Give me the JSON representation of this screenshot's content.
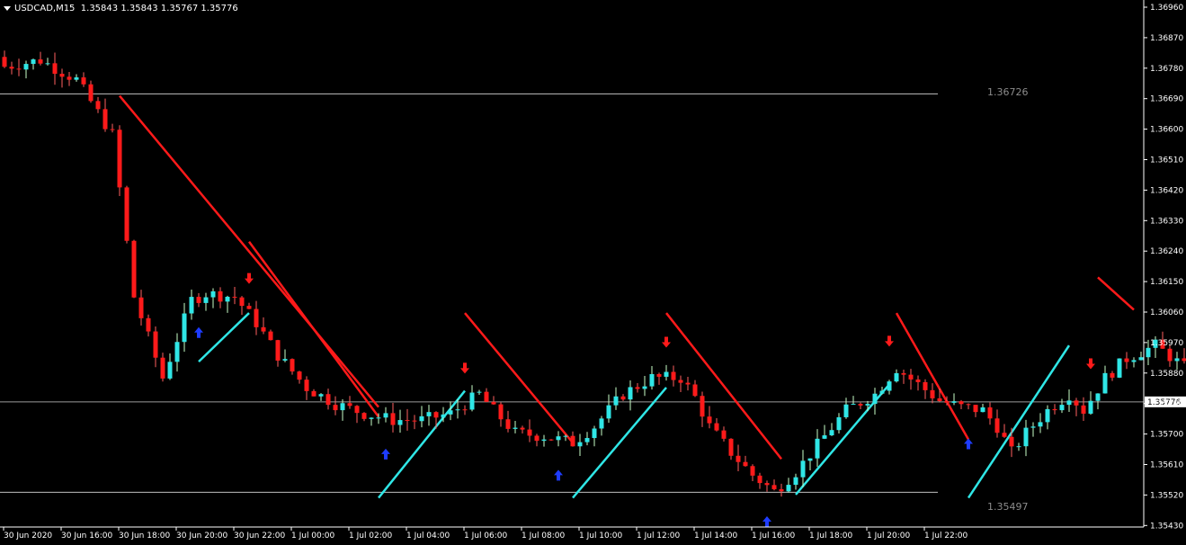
{
  "header": {
    "symbol": "USDCAD,M15",
    "ohlc": "1.35843 1.35843 1.35767 1.35776"
  },
  "levels": {
    "upper": "1.36726",
    "lower": "1.35497",
    "current": "1.35776"
  },
  "colors": {
    "background": "#000000",
    "bull": "#2fe6e6",
    "bear": "#ff1a1a",
    "buy_arrow": "#1e3cff",
    "sell_arrow": "#ff1a1a",
    "level_line": "#bfbfbf"
  },
  "chart_data": {
    "type": "candlestick",
    "ylim": [
      1.3539,
      1.3701
    ],
    "y_ticks": [
      "1.36960",
      "1.36870",
      "1.36780",
      "1.36690",
      "1.36600",
      "1.36510",
      "1.36420",
      "1.36330",
      "1.36240",
      "1.36150",
      "1.36060",
      "1.35970",
      "1.35880",
      "1.35790",
      "1.35700",
      "1.35610",
      "1.35520",
      "1.35430"
    ],
    "x_ticks": [
      "30 Jun 2020",
      "30 Jun 16:00",
      "30 Jun 18:00",
      "30 Jun 20:00",
      "30 Jun 22:00",
      "1 Jul 00:00",
      "1 Jul 02:00",
      "1 Jul 04:00",
      "1 Jul 06:00",
      "1 Jul 08:00",
      "1 Jul 10:00",
      "1 Jul 12:00",
      "1 Jul 14:00",
      "1 Jul 16:00",
      "1 Jul 18:00",
      "1 Jul 20:00",
      "1 Jul 22:00"
    ],
    "horizontal_levels": [
      1.36726,
      1.35497,
      1.35776
    ],
    "candle_close_path": [
      [
        0,
        1.3681
      ],
      [
        5,
        1.3683
      ],
      [
        10,
        1.3677
      ],
      [
        15,
        1.366
      ],
      [
        18,
        1.361
      ],
      [
        22,
        1.3585
      ],
      [
        26,
        1.3609
      ],
      [
        28,
        1.3611
      ],
      [
        32,
        1.361
      ],
      [
        35,
        1.3602
      ],
      [
        38,
        1.3592
      ],
      [
        42,
        1.3582
      ],
      [
        46,
        1.3577
      ],
      [
        50,
        1.3574
      ],
      [
        54,
        1.3572
      ],
      [
        58,
        1.3572
      ],
      [
        62,
        1.3574
      ],
      [
        66,
        1.358
      ],
      [
        68,
        1.3575
      ],
      [
        71,
        1.3568
      ],
      [
        75,
        1.3567
      ],
      [
        79,
        1.3565
      ],
      [
        82,
        1.357
      ],
      [
        86,
        1.358
      ],
      [
        90,
        1.3585
      ],
      [
        94,
        1.3585
      ],
      [
        96,
        1.3579
      ],
      [
        98,
        1.357
      ],
      [
        101,
        1.3562
      ],
      [
        104,
        1.3555
      ],
      [
        107,
        1.355
      ],
      [
        110,
        1.3556
      ],
      [
        114,
        1.3567
      ],
      [
        117,
        1.3575
      ],
      [
        121,
        1.358
      ],
      [
        124,
        1.3588
      ],
      [
        127,
        1.3583
      ],
      [
        130,
        1.3578
      ],
      [
        133,
        1.3576
      ],
      [
        136,
        1.3575
      ],
      [
        138,
        1.357
      ],
      [
        140,
        1.3562
      ],
      [
        142,
        1.3568
      ],
      [
        145,
        1.3575
      ],
      [
        148,
        1.358
      ],
      [
        150,
        1.3575
      ],
      [
        153,
        1.3585
      ],
      [
        156,
        1.3591
      ],
      [
        160,
        1.3595
      ],
      [
        163,
        1.359
      ],
      [
        166,
        1.3585
      ]
    ],
    "buy_arrows": [
      27,
      53,
      77,
      106,
      134
    ],
    "sell_arrows": [
      34,
      64,
      92,
      123,
      151
    ],
    "bull_trendlines": [
      [
        27,
        1.359,
        34,
        1.3605
      ],
      [
        52,
        1.3548,
        64,
        1.3581
      ],
      [
        79,
        1.3548,
        92,
        1.3582
      ],
      [
        110,
        1.3549,
        123,
        1.3583
      ],
      [
        134,
        1.3548,
        148,
        1.3595
      ]
    ],
    "bear_trendlines": [
      [
        16,
        1.3672,
        52,
        1.3576
      ],
      [
        34,
        1.3627,
        52,
        1.3573
      ],
      [
        64,
        1.3605,
        79,
        1.3565
      ],
      [
        92,
        1.3605,
        108,
        1.356
      ],
      [
        124,
        1.3605,
        134,
        1.3566
      ],
      [
        152,
        1.3616,
        157,
        1.3606
      ]
    ]
  }
}
